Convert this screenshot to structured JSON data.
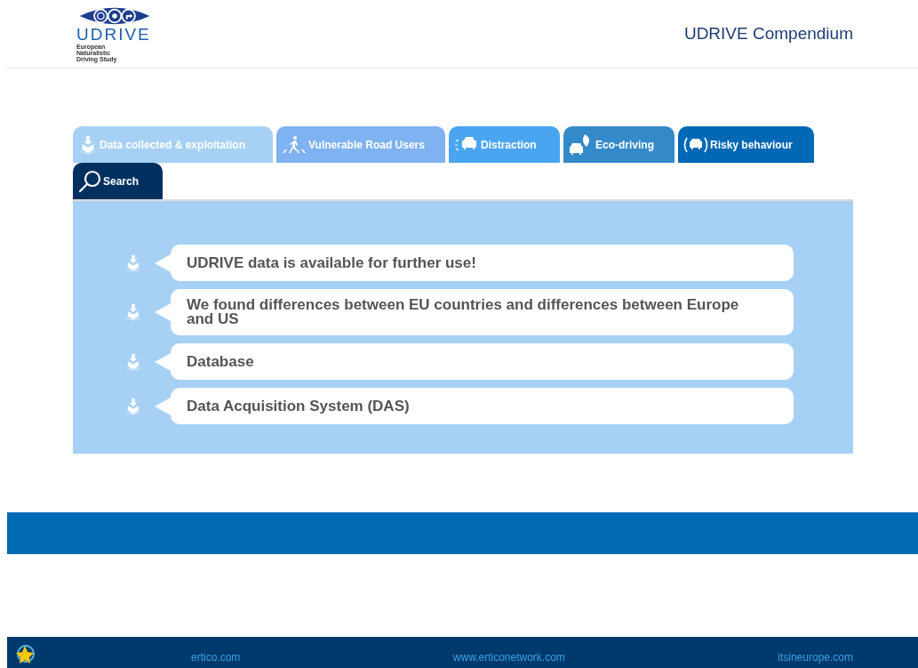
{
  "header": {
    "logo_text": "UDRIVE",
    "logo_subtitle": "European Naturalistic Driving Study",
    "title": "UDRIVE Compendium"
  },
  "tabs": [
    {
      "label": "Data collected & exploitation",
      "color": "#a6d1f5"
    },
    {
      "label": "Vulnerable Road Users",
      "color": "#7fb2f0"
    },
    {
      "label": "Distraction",
      "color": "#4aa5f0"
    },
    {
      "label": "Eco-driving",
      "color": "#348ac8"
    },
    {
      "label": "Risky behaviour",
      "color": "#0068b4"
    },
    {
      "label": "Search",
      "color": "#00305f"
    }
  ],
  "items": [
    "UDRIVE data is available for further use!",
    "We found differences between EU countries and differences between Europe and US",
    "Database",
    "Data Acquisition System (DAS)"
  ],
  "footer": {
    "links": [
      "ertico.com",
      "www.erticonetwork.com",
      "itsineurope.com"
    ]
  }
}
